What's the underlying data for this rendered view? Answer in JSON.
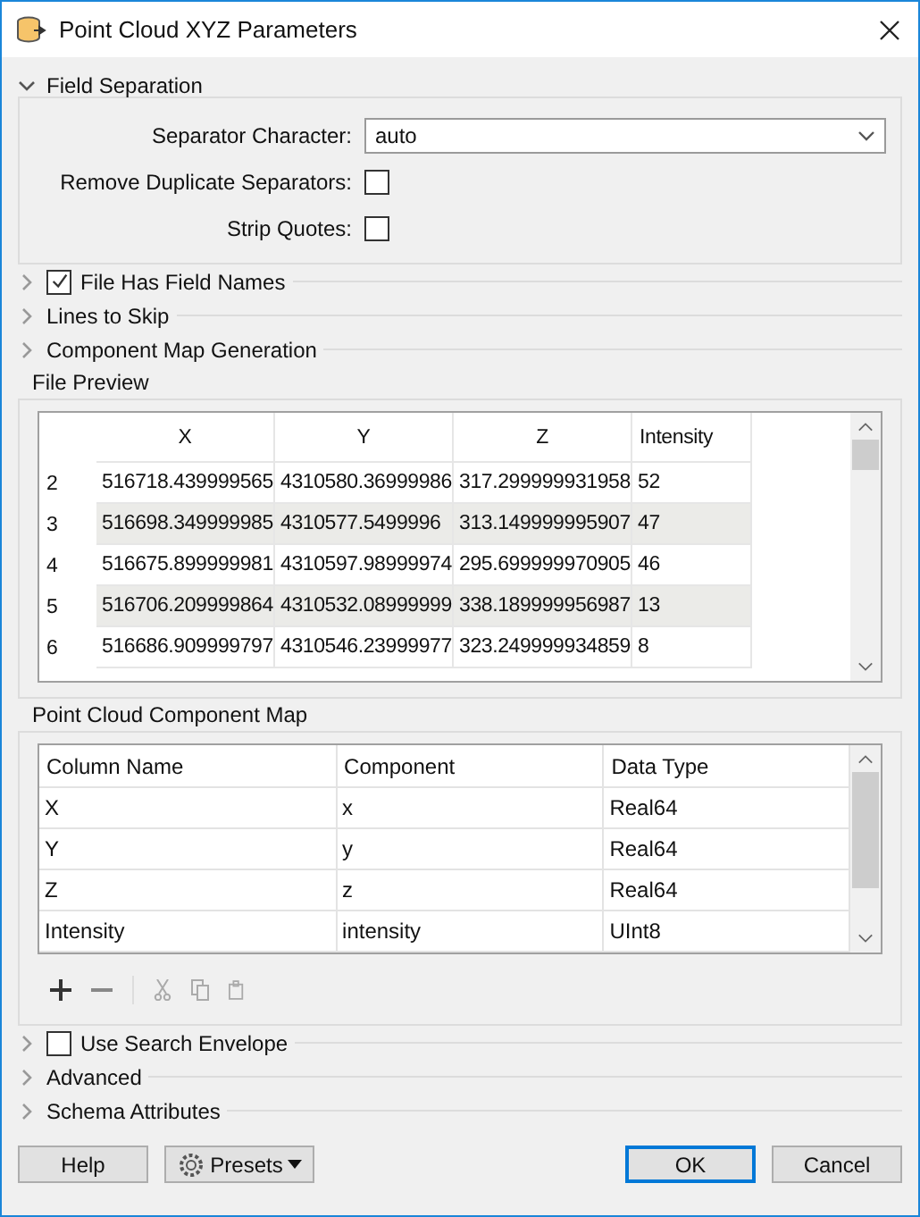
{
  "window": {
    "title": "Point Cloud XYZ Parameters"
  },
  "field_separation": {
    "title": "Field Separation",
    "expanded": true,
    "fields": [
      {
        "kind": "dropdown",
        "label": "Separator Character:",
        "value": "auto"
      },
      {
        "kind": "checkbox",
        "label": "Remove Duplicate Separators:",
        "checked": false
      },
      {
        "kind": "checkbox",
        "label": "Strip Quotes:",
        "checked": false
      }
    ]
  },
  "options_top": [
    {
      "kind": "checkbox",
      "label": "File Has Field Names",
      "checked": true,
      "expanded": false
    },
    {
      "kind": "plain",
      "label": "Lines to Skip",
      "expanded": false
    },
    {
      "kind": "plain",
      "label": "Component Map Generation",
      "expanded": false
    }
  ],
  "file_preview": {
    "title": "File Preview",
    "columns": [
      "X",
      "Y",
      "Z",
      "Intensity"
    ],
    "rows": [
      {
        "index": "2",
        "cells": [
          "516718.439999565",
          "4310580.36999986",
          "317.299999931958",
          "52"
        ]
      },
      {
        "index": "3",
        "cells": [
          "516698.349999985",
          "4310577.5499996",
          "313.149999995907",
          "47"
        ]
      },
      {
        "index": "4",
        "cells": [
          "516675.899999981",
          "4310597.98999974",
          "295.699999970905",
          "46"
        ]
      },
      {
        "index": "5",
        "cells": [
          "516706.209999864",
          "4310532.08999999",
          "338.189999956987",
          "13"
        ]
      },
      {
        "index": "6",
        "cells": [
          "516686.909999797",
          "4310546.23999977",
          "323.249999934859",
          "8"
        ]
      }
    ]
  },
  "component_map": {
    "title": "Point Cloud Component Map",
    "columns": [
      "Column Name",
      "Component",
      "Data Type"
    ],
    "rows": [
      [
        "X",
        "x",
        "Real64"
      ],
      [
        "Y",
        "y",
        "Real64"
      ],
      [
        "Z",
        "z",
        "Real64"
      ],
      [
        "Intensity",
        "intensity",
        "UInt8"
      ]
    ],
    "toolbar": [
      {
        "kind": "add",
        "disabled": false
      },
      {
        "kind": "remove",
        "disabled": false
      },
      {
        "kind": "cut",
        "disabled": true
      },
      {
        "kind": "copy",
        "disabled": true
      },
      {
        "kind": "paste",
        "disabled": true
      }
    ]
  },
  "options_bottom": [
    {
      "kind": "checkbox",
      "label": "Use Search Envelope",
      "checked": false,
      "expanded": false
    },
    {
      "kind": "plain",
      "label": "Advanced",
      "expanded": false
    },
    {
      "kind": "plain",
      "label": "Schema Attributes",
      "expanded": false
    }
  ],
  "buttons": [
    {
      "kind": "plain",
      "label": "Help",
      "default": false
    },
    {
      "kind": "menu",
      "label": "Presets",
      "default": false
    },
    {
      "kind": "plain",
      "label": "OK",
      "default": true
    },
    {
      "kind": "plain",
      "label": "Cancel",
      "default": false
    }
  ]
}
